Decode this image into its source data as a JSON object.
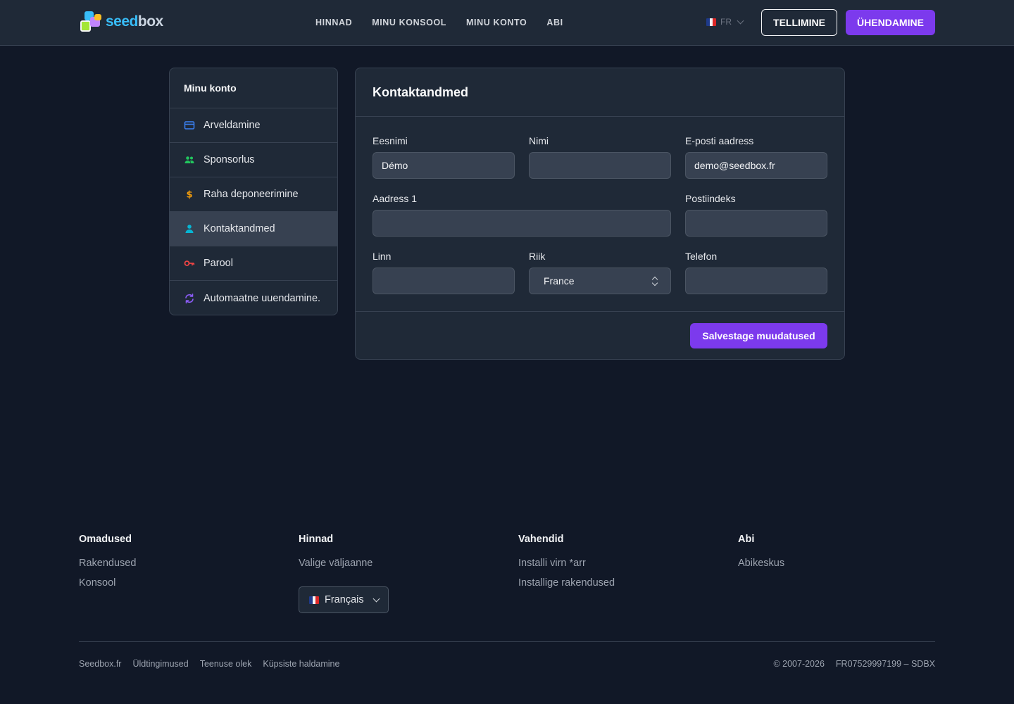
{
  "header": {
    "logo": {
      "text_a": "seed",
      "text_b": "box"
    },
    "nav": [
      "HINNAD",
      "MINU KONSOOL",
      "MINU KONTO",
      "ABI"
    ],
    "lang_code": "FR",
    "order_label": "TELLIMINE",
    "login_label": "ÜHENDAMINE"
  },
  "sidebar": {
    "title": "Minu konto",
    "items": [
      {
        "label": "Arveldamine",
        "icon": "credit-card-icon",
        "color": "#3b82f6"
      },
      {
        "label": "Sponsorlus",
        "icon": "users-icon",
        "color": "#22c55e"
      },
      {
        "label": "Raha deponeerimine",
        "icon": "dollar-icon",
        "color": "#f59e0b"
      },
      {
        "label": "Kontaktandmed",
        "icon": "user-icon",
        "color": "#06b6d4",
        "active": true
      },
      {
        "label": "Parool",
        "icon": "key-icon",
        "color": "#ef4444"
      },
      {
        "label": "Automaatne uuendamine.",
        "icon": "refresh-icon",
        "color": "#8b5cf6"
      }
    ]
  },
  "form": {
    "title": "Kontaktandmed",
    "first_name": {
      "label": "Eesnimi",
      "value": "Démo"
    },
    "last_name": {
      "label": "Nimi",
      "value": ""
    },
    "email": {
      "label": "E-posti aadress",
      "value": "demo@seedbox.fr"
    },
    "address": {
      "label": "Aadress 1",
      "value": ""
    },
    "postcode": {
      "label": "Postiindeks",
      "value": ""
    },
    "city": {
      "label": "Linn",
      "value": ""
    },
    "country": {
      "label": "Riik",
      "value": "France"
    },
    "phone": {
      "label": "Telefon",
      "value": ""
    },
    "save_label": "Salvestage muudatused"
  },
  "footer": {
    "columns": [
      {
        "title": "Omadused",
        "links": [
          "Rakendused",
          "Konsool"
        ]
      },
      {
        "title": "Hinnad",
        "links": [
          "Valige väljaanne"
        ]
      },
      {
        "title": "Vahendid",
        "links": [
          "Installi virn *arr",
          "Installige rakendused"
        ]
      },
      {
        "title": "Abi",
        "links": [
          "Abikeskus"
        ]
      }
    ],
    "language": "Français",
    "legal": [
      "Seedbox.fr",
      "Üldtingimused",
      "Teenuse olek",
      "Küpsiste haldamine"
    ],
    "copyright": "© 2007-2026",
    "company": "FR07529997199 – SDBX"
  },
  "colors": {
    "accent": "#7c3aed",
    "background": "#111827",
    "panel": "#1f2937"
  }
}
